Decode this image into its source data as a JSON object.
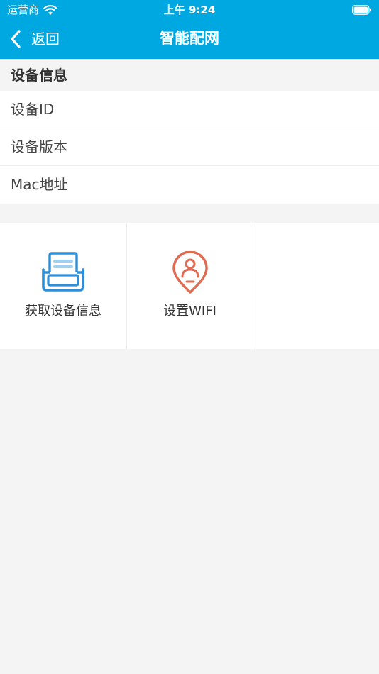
{
  "status_bar": {
    "carrier": "运营商",
    "time": "上午 9:24",
    "wifi_icon": "wifi-icon",
    "battery_icon": "battery-icon"
  },
  "nav": {
    "back_label": "返回",
    "title": "智能配网",
    "back_icon": "chevron-left-icon"
  },
  "device_info": {
    "header": "设备信息",
    "rows": [
      {
        "label": "设备ID"
      },
      {
        "label": "设备版本"
      },
      {
        "label": "Mac地址"
      }
    ]
  },
  "actions": [
    {
      "label": "获取设备信息",
      "icon": "printer-icon",
      "color": "#2e8fd6"
    },
    {
      "label": "设置WIFI",
      "icon": "location-user-icon",
      "color": "#e06a52"
    },
    {
      "label": "",
      "icon": ""
    }
  ],
  "colors": {
    "accent": "#00a8e1",
    "background": "#f4f4f4"
  }
}
